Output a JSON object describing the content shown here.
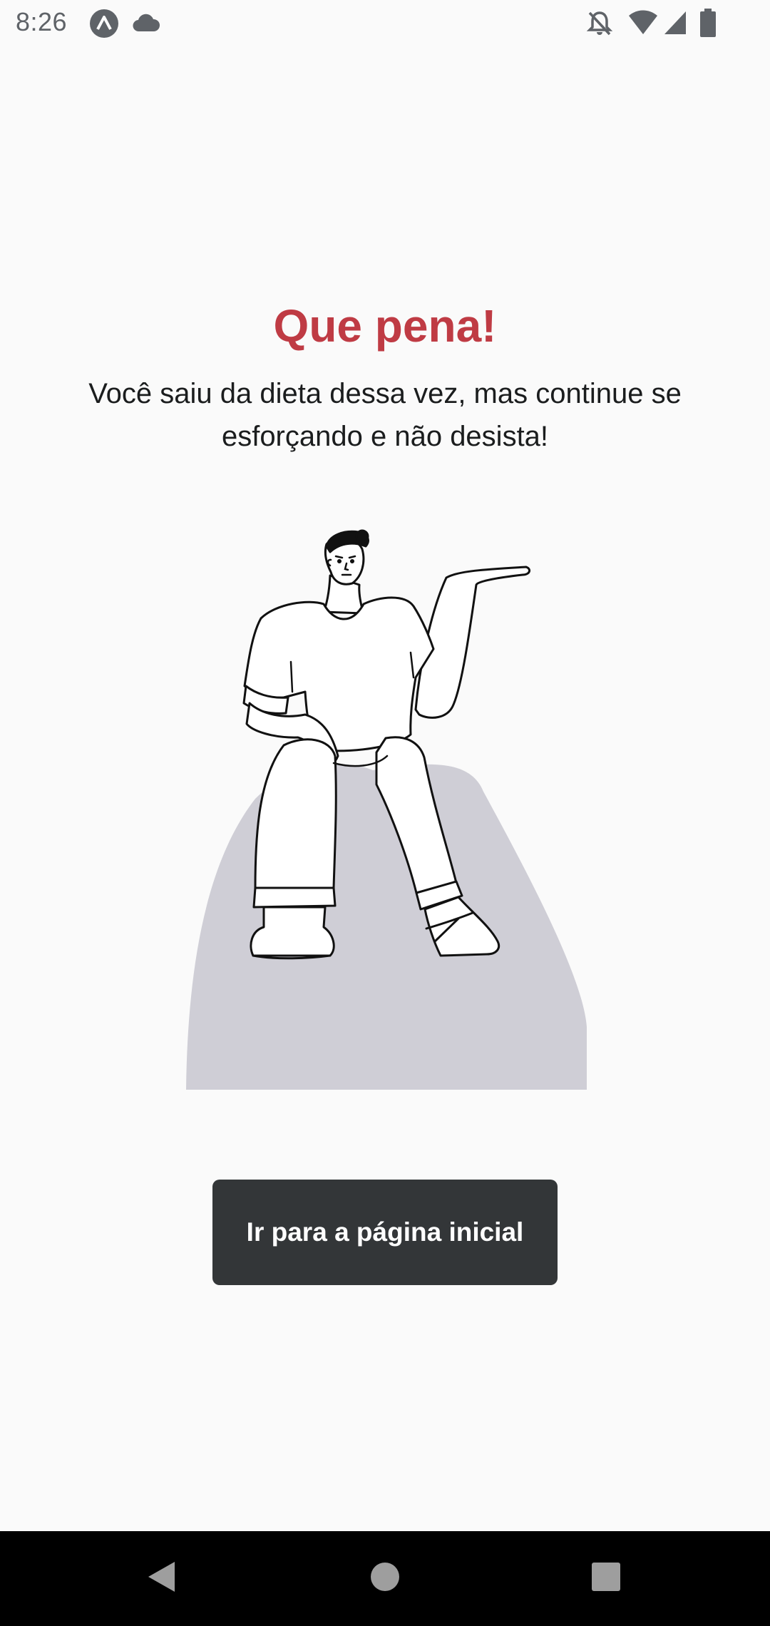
{
  "status_bar": {
    "time": "8:26",
    "icons": [
      "app-notification-icon",
      "cloud-icon",
      "notifications-off-icon",
      "wifi-icon",
      "cellular-signal-icon",
      "battery-icon"
    ]
  },
  "feedback": {
    "title": "Que pena!",
    "message": "Você saiu da dieta dessa vez, mas continue se esforçando e não desista!",
    "title_color": "#BF3B44",
    "illustration": "person-sitting-illustration"
  },
  "actions": {
    "home_button_label": "Ir para a página inicial",
    "button_color": "#333638"
  },
  "nav_bar": {
    "buttons": [
      "back-icon",
      "home-icon",
      "recents-icon"
    ]
  }
}
